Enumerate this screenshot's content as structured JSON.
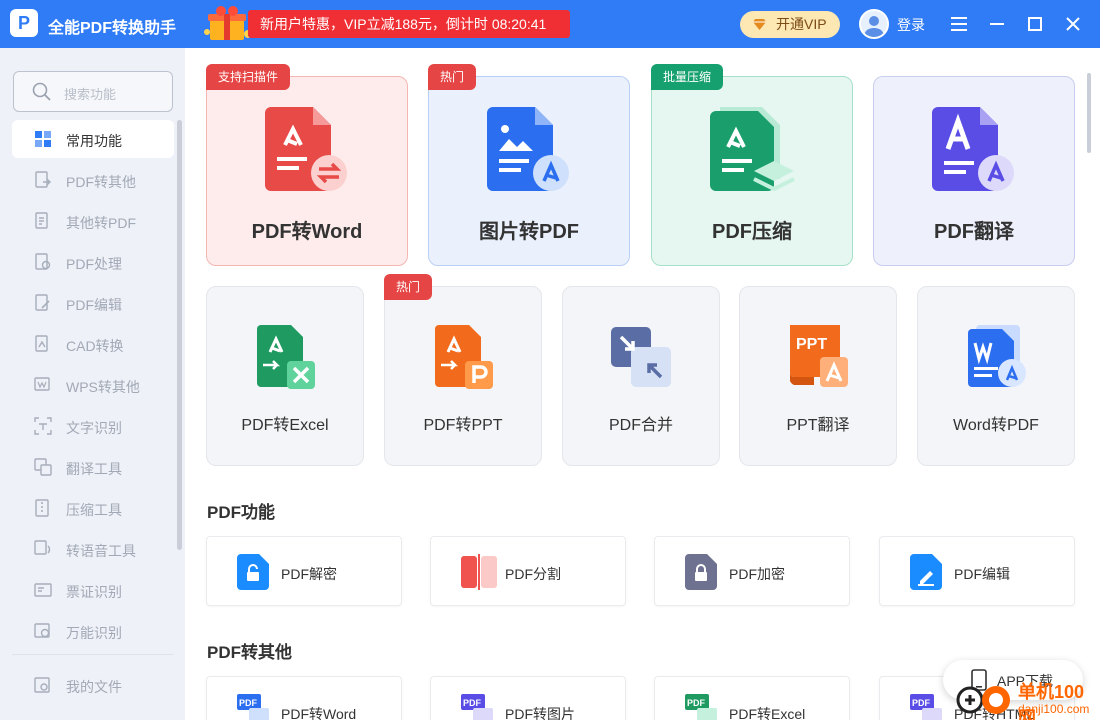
{
  "app": {
    "title": "全能PDF转换助手",
    "logo_letter": "P"
  },
  "promo": {
    "text": "新用户特惠，VIP立减188元，倒计时 08:20:41"
  },
  "header": {
    "vip_label": "开通VIP",
    "login_label": "登录"
  },
  "search": {
    "placeholder": "搜索功能"
  },
  "sidebar": {
    "items": [
      {
        "label": "常用功能",
        "icon": "grid-icon",
        "active": true
      },
      {
        "label": "PDF转其他",
        "icon": "pdf-convert-icon"
      },
      {
        "label": "其他转PDF",
        "icon": "to-pdf-icon"
      },
      {
        "label": "PDF处理",
        "icon": "pdf-process-icon"
      },
      {
        "label": "PDF编辑",
        "icon": "pdf-edit-icon"
      },
      {
        "label": "CAD转换",
        "icon": "cad-icon"
      },
      {
        "label": "WPS转其他",
        "icon": "wps-icon"
      },
      {
        "label": "文字识别",
        "icon": "ocr-icon"
      },
      {
        "label": "翻译工具",
        "icon": "translate-icon"
      },
      {
        "label": "压缩工具",
        "icon": "compress-icon"
      },
      {
        "label": "转语音工具",
        "icon": "speech-icon"
      },
      {
        "label": "票证识别",
        "icon": "ticket-icon"
      },
      {
        "label": "万能识别",
        "icon": "scan-icon"
      }
    ],
    "footer": {
      "label": "我的文件",
      "icon": "folder-icon"
    }
  },
  "big_cards": [
    {
      "label": "PDF转Word",
      "tag": "支持扫描件",
      "tag_color": "#e64545",
      "bg": "#fdeceb",
      "border": "#f4b6b2"
    },
    {
      "label": "图片转PDF",
      "tag": "热门",
      "tag_color": "#e64545",
      "bg": "#eaf1fd",
      "border": "#b9cff5"
    },
    {
      "label": "PDF压缩",
      "tag": "批量压缩",
      "tag_color": "#17a06f",
      "bg": "#e5f7f0",
      "border": "#a6e0c8"
    },
    {
      "label": "PDF翻译",
      "tag": "",
      "tag_color": "",
      "bg": "#eef0fb",
      "border": "#c9cdef"
    }
  ],
  "mid_cards": [
    {
      "label": "PDF转Excel",
      "tag": ""
    },
    {
      "label": "PDF转PPT",
      "tag": "热门"
    },
    {
      "label": "PDF合并",
      "tag": ""
    },
    {
      "label": "PPT翻译",
      "tag": ""
    },
    {
      "label": "Word转PDF",
      "tag": ""
    }
  ],
  "sections": {
    "pdf_functions": {
      "title": "PDF功能",
      "items": [
        {
          "label": "PDF解密",
          "icon": "unlock-icon"
        },
        {
          "label": "PDF分割",
          "icon": "split-icon"
        },
        {
          "label": "PDF加密",
          "icon": "lock-icon"
        },
        {
          "label": "PDF编辑",
          "icon": "edit-icon"
        }
      ]
    },
    "pdf_to_other": {
      "title": "PDF转其他",
      "items": [
        {
          "label": "PDF转Word"
        },
        {
          "label": "PDF转图片"
        },
        {
          "label": "PDF转Excel"
        },
        {
          "label": "PDF转HTML"
        }
      ]
    }
  },
  "app_download": {
    "label": "APP下载"
  },
  "watermark": {
    "title": "单机100网",
    "url": "danji100.com"
  },
  "colors": {
    "titlebar": "#2f7cf6",
    "promo": "#ef2f34",
    "sidebar": "#eef1f7",
    "vip_bg": "#fde7b2"
  }
}
